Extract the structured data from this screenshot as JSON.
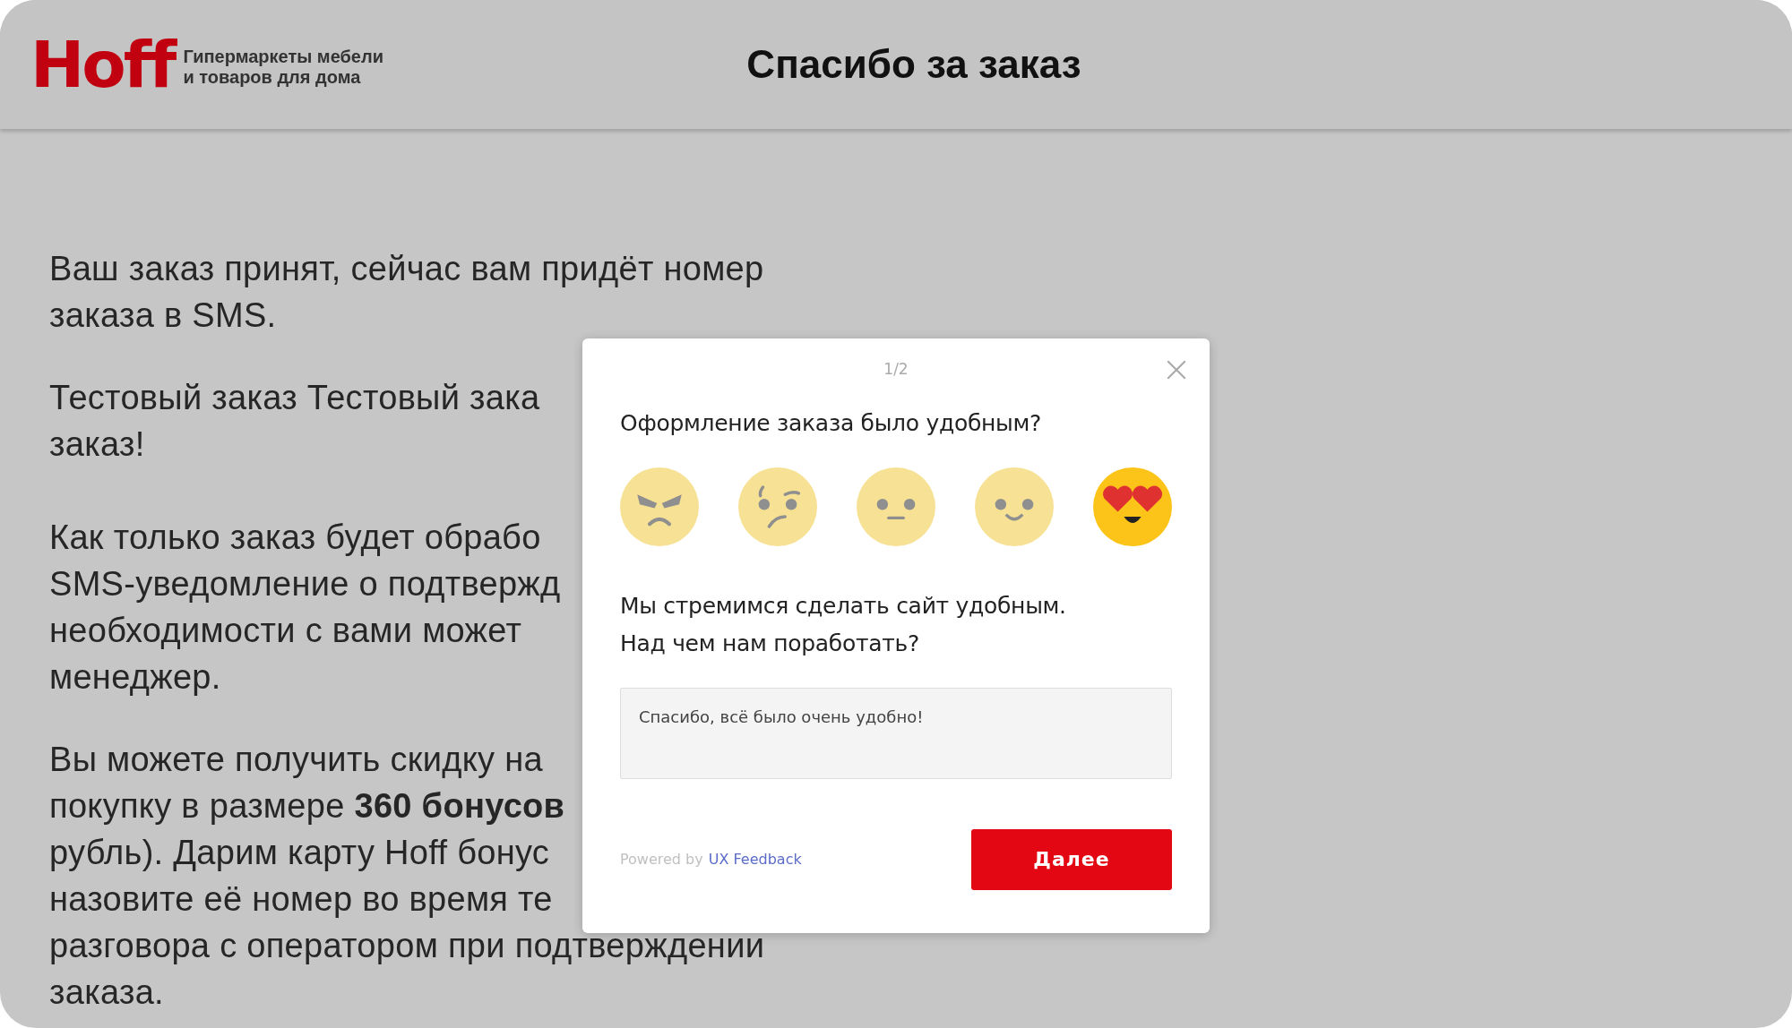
{
  "header": {
    "logo": "Hoff",
    "tagline": [
      "Гипермаркеты мебели",
      "и товаров для дома"
    ],
    "title": "Спасибо за заказ"
  },
  "content": {
    "paragraphs": [
      {
        "lines": [
          "Ваш заказ принят, сейчас вам придёт номер",
          "заказа в SMS."
        ]
      },
      {
        "lines": [
          "Тестовый заказ Тестовый зака",
          "заказ!"
        ]
      },
      {
        "lines": [
          "Как только заказ будет обрабо",
          "SMS-уведомление о подтвержд",
          "необходимости с вами может",
          "менеджер."
        ]
      },
      {
        "lines": [
          "Вы можете получить скидку на",
          "покупку в размере **360 бонусов**",
          "рубль). Дарим карту Hoff бонус",
          "назовите её номер во время те",
          "разговора с оператором при подтверждении",
          "заказа."
        ]
      }
    ]
  },
  "survey": {
    "step": "1/2",
    "question": "Оформление заказа было удобным?",
    "ratings": [
      {
        "kind": "angry",
        "selected": false
      },
      {
        "kind": "skeptical",
        "selected": false
      },
      {
        "kind": "neutral",
        "selected": false
      },
      {
        "kind": "smile",
        "selected": false
      },
      {
        "kind": "love",
        "selected": true
      }
    ],
    "prompt": [
      "Мы стремимся сделать сайт удобным.",
      "Над чем нам поработать?"
    ],
    "answer": "Спасибо, всё было очень удобно!",
    "powered_by": "Powered by",
    "powered_link": "UX Feedback",
    "button": "Далее"
  }
}
